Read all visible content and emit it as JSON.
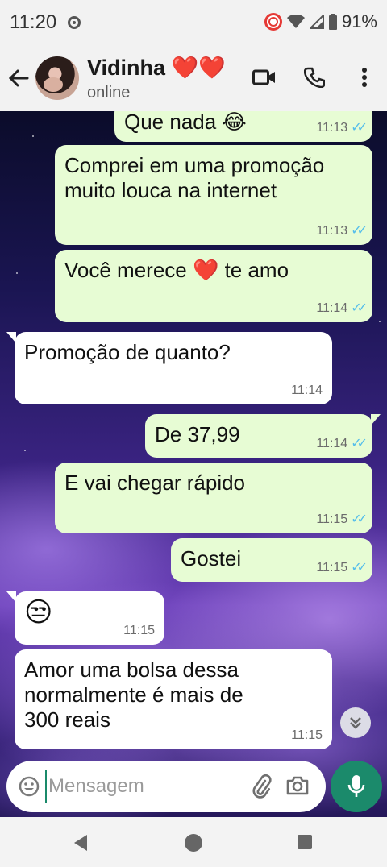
{
  "status_bar": {
    "time": "11:20",
    "battery": "91%",
    "icons": [
      "record-icon",
      "wifi-icon",
      "signal-icon",
      "battery-icon"
    ]
  },
  "header": {
    "name": "Vidinha ❤️❤️",
    "status": "online",
    "icons": [
      "back-arrow-icon",
      "video-call-icon",
      "phone-call-icon",
      "more-vert-icon"
    ]
  },
  "messages": [
    {
      "dir": "out",
      "text": "Que nada 😂",
      "time": "11:13",
      "read": true
    },
    {
      "dir": "out",
      "text": "Comprei em uma promoção muito louca na internet",
      "time": "11:13",
      "read": true
    },
    {
      "dir": "out",
      "text": "Você merece ❤️ te amo",
      "time": "11:14",
      "read": true
    },
    {
      "dir": "in",
      "text": "Promoção de quanto?",
      "time": "11:14"
    },
    {
      "dir": "out",
      "text": "De 37,99",
      "time": "11:14",
      "read": true
    },
    {
      "dir": "out",
      "text": "E vai chegar rápido",
      "time": "11:15",
      "read": true
    },
    {
      "dir": "out",
      "text": "Gostei",
      "time": "11:15",
      "read": true
    },
    {
      "dir": "in",
      "text": "😒",
      "time": "11:15"
    },
    {
      "dir": "in",
      "text": "Amor uma bolsa dessa normalmente é mais de 300 reais",
      "time": "11:15"
    }
  ],
  "composer": {
    "placeholder": "Mensagem",
    "icons": [
      "emoji-icon",
      "attach-icon",
      "camera-icon",
      "mic-icon"
    ]
  },
  "colors": {
    "outgoing_bubble": "#e7fcd4",
    "incoming_bubble": "#ffffff",
    "read_ticks": "#53bdeb",
    "accent": "#1b8a6b"
  }
}
